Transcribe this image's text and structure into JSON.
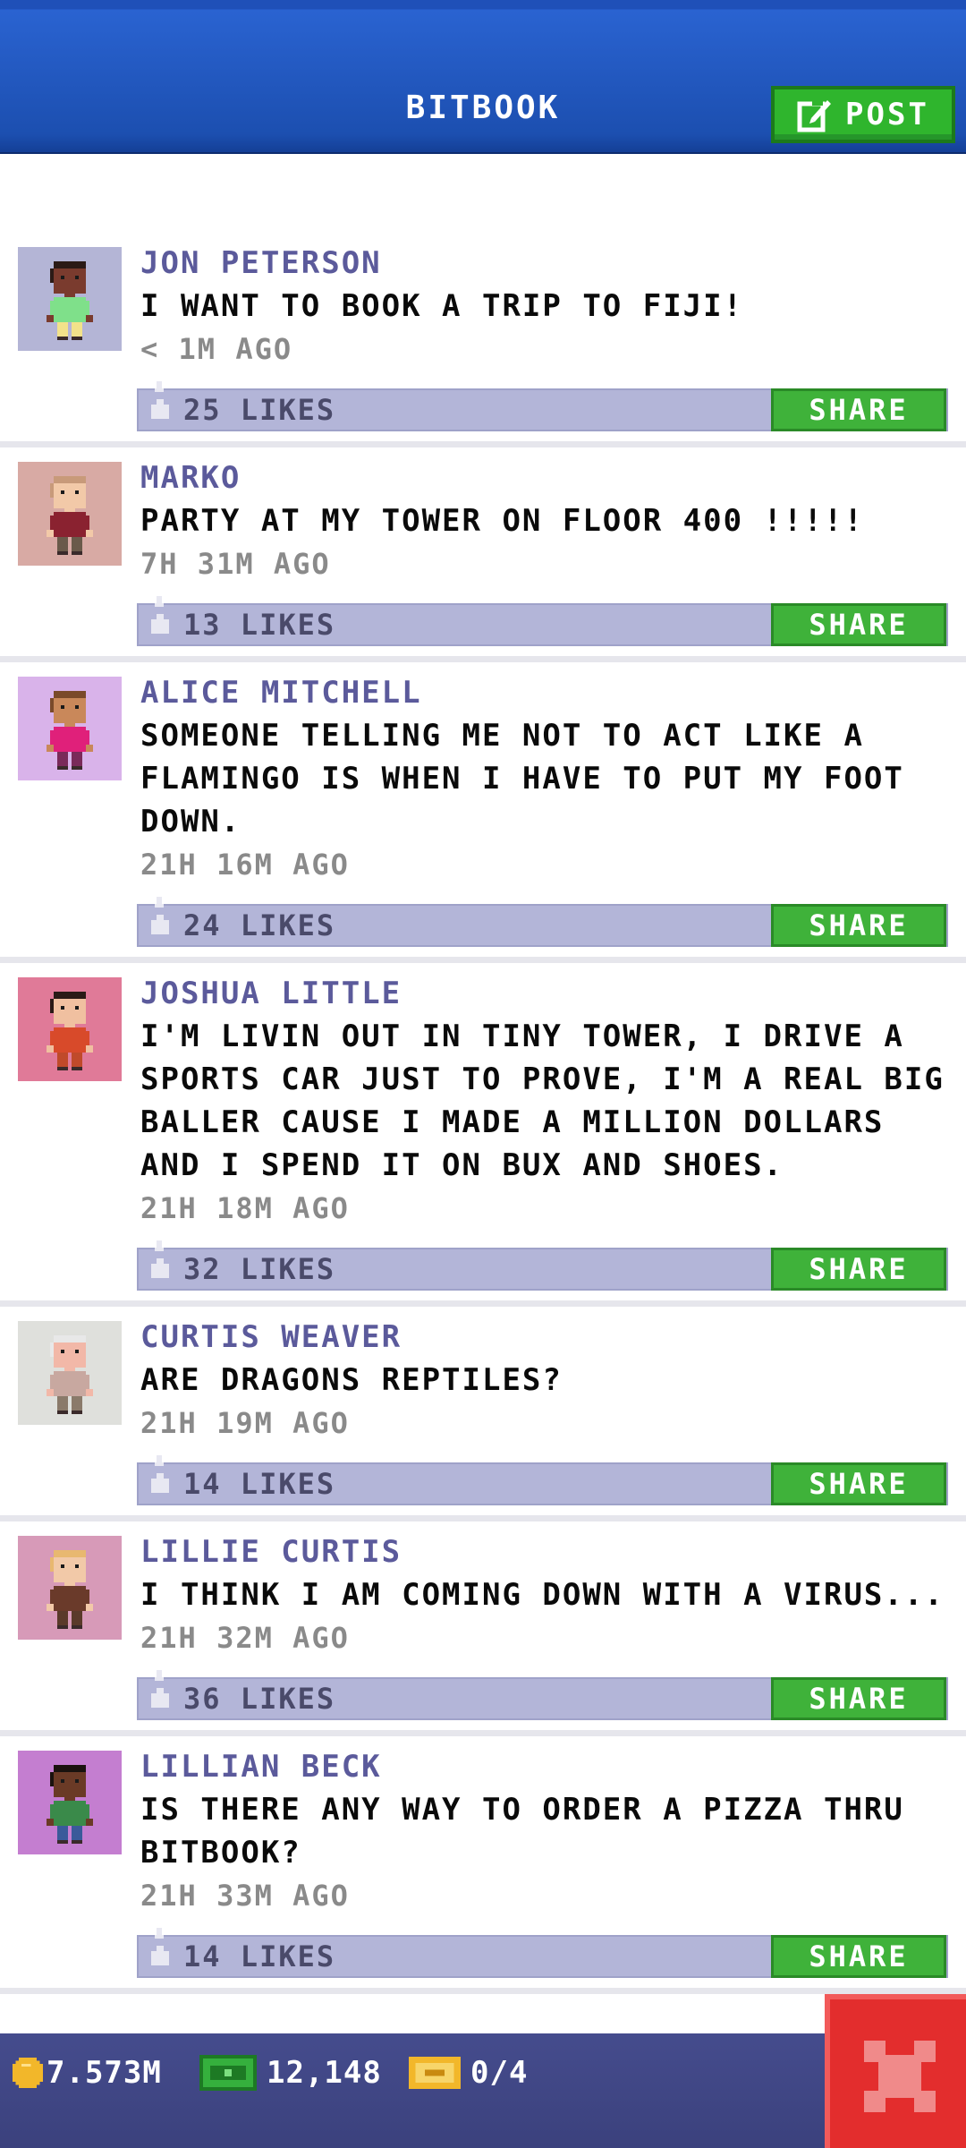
{
  "header": {
    "title": "BITBOOK",
    "post_label": "POST"
  },
  "posts": [
    {
      "name": "JON PETERSON",
      "text": "I WANT TO BOOK A TRIP TO FIJI!",
      "time": "< 1M AGO",
      "likes": "25 LIKES",
      "share": "SHARE",
      "avatar_bg": "#b4b5d6",
      "skin": "#7a3b2e",
      "hair": "#2b1a16",
      "shirt": "#7fe08a",
      "pants": "#f2e28a"
    },
    {
      "name": "MARKO",
      "text": "PARTY AT MY TOWER ON FLOOR 400 !!!!!",
      "time": "7H 31M AGO",
      "likes": "13 LIKES",
      "share": "SHARE",
      "avatar_bg": "#d8aaa4",
      "skin": "#f2c9a8",
      "hair": "#c89a7a",
      "shirt": "#8a2230",
      "pants": "#6a5a4a"
    },
    {
      "name": "ALICE MITCHELL",
      "text": "SOMEONE TELLING ME NOT TO ACT LIKE A FLAMINGO IS WHEN I HAVE TO PUT MY FOOT DOWN.",
      "time": "21H 16M AGO",
      "likes": "24 LIKES",
      "share": "SHARE",
      "avatar_bg": "#d9b3ea",
      "skin": "#c9885a",
      "hair": "#7a4a2a",
      "shirt": "#e0207a",
      "pants": "#7a2a5a"
    },
    {
      "name": "JOSHUA LITTLE",
      "text": "I'M LIVIN OUT IN TINY TOWER, I DRIVE A SPORTS CAR JUST TO PROVE, I'M A REAL BIG BALLER CAUSE I MADE A MILLION DOLLARS AND I SPEND IT ON BUX AND SHOES.",
      "time": "21H 18M AGO",
      "likes": "32 LIKES",
      "share": "SHARE",
      "avatar_bg": "#e07a98",
      "skin": "#f0c0a0",
      "hair": "#2a1a16",
      "shirt": "#d84a2a",
      "pants": "#c04a2a"
    },
    {
      "name": "CURTIS WEAVER",
      "text": "ARE DRAGONS REPTILES?",
      "time": "21H 19M AGO",
      "likes": "14 LIKES",
      "share": "SHARE",
      "avatar_bg": "#dfe0dc",
      "skin": "#f2b8a8",
      "hair": "#e8e8e8",
      "shirt": "#c8a8a0",
      "pants": "#8a7a6a"
    },
    {
      "name": "LILLIE CURTIS",
      "text": "I THINK I AM COMING DOWN WITH A VIRUS...",
      "time": "21H 32M AGO",
      "likes": "36 LIKES",
      "share": "SHARE",
      "avatar_bg": "#d79ab8",
      "skin": "#f2c9a8",
      "hair": "#e8b870",
      "shirt": "#6a3a2a",
      "pants": "#5a3a2a"
    },
    {
      "name": "LILLIAN BECK",
      "text": "IS THERE ANY WAY TO ORDER A PIZZA THRU BITBOOK?",
      "time": "21H 33M AGO",
      "likes": "14 LIKES",
      "share": "SHARE",
      "avatar_bg": "#c47ed0",
      "skin": "#6a3a26",
      "hair": "#1a120e",
      "shirt": "#3a8a4a",
      "pants": "#3a5a9a"
    }
  ],
  "footer": {
    "coins": "7.573M",
    "bux": "12,148",
    "tickets": "0/4"
  },
  "colors": {
    "accent_blue": "#1f50b8",
    "share_green": "#3fb23a",
    "close_red": "#e32d2d",
    "name_purple": "#5b5a9b"
  },
  "icons": {
    "post": "edit-icon",
    "like": "thumbs-up-icon",
    "coin": "coin-icon",
    "bux": "bux-icon",
    "ticket": "ticket-icon",
    "close": "close-icon"
  }
}
